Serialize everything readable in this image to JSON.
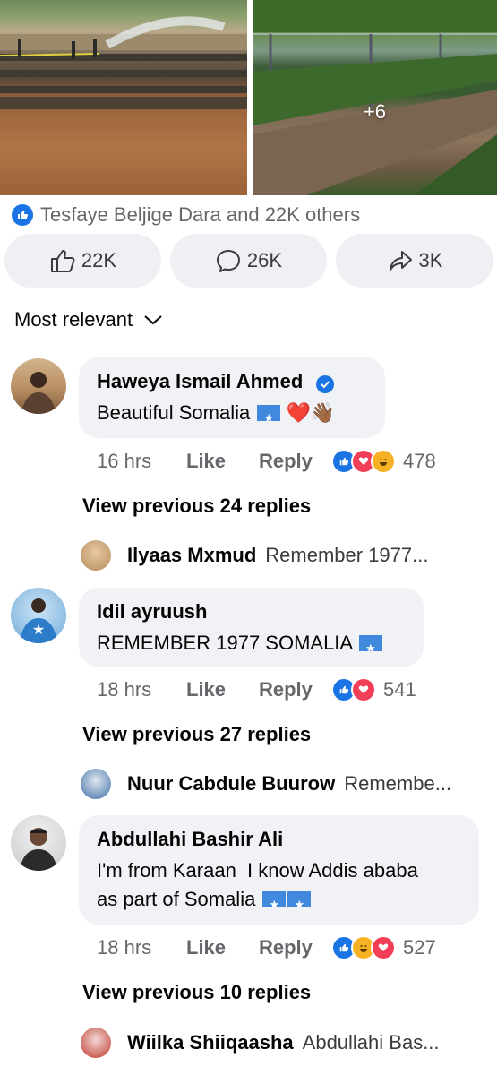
{
  "post": {
    "more_photos": "+6",
    "reactions_summary": "Tesfaye Beljige Dara and 22K others",
    "actions": {
      "like_count": "22K",
      "comment_count": "26K",
      "share_count": "3K"
    }
  },
  "sort": {
    "label": "Most relevant"
  },
  "comments": [
    {
      "name": "Haweya Ismail Ahmed",
      "verified": true,
      "text": "Beautiful Somalia",
      "emoji": "❤️👋🏾",
      "time": "16 hrs",
      "like": "Like",
      "reply": "Reply",
      "reactions": [
        "like",
        "love",
        "haha"
      ],
      "reaction_count": "478",
      "view_previous": "View previous 24 replies",
      "latest_reply": {
        "name": "Ilyaas Mxmud",
        "text": "Remember 1977..."
      }
    },
    {
      "name": "Idil ayruush",
      "verified": false,
      "text": "REMEMBER 1977 SOMALIA",
      "time": "18 hrs",
      "like": "Like",
      "reply": "Reply",
      "reactions": [
        "like",
        "love"
      ],
      "reaction_count": "541",
      "view_previous": "View previous 27 replies",
      "latest_reply": {
        "name": "Nuur Cabdule Buurow",
        "text": "Remembe..."
      }
    },
    {
      "name": "Abdullahi Bashir Ali",
      "verified": false,
      "text_line1": "I'm from Karaan  I know Addis ababa",
      "text_line2": "as part of Somalia",
      "time": "18 hrs",
      "like": "Like",
      "reply": "Reply",
      "reactions": [
        "like",
        "haha",
        "love"
      ],
      "reaction_count": "527",
      "view_previous": "View previous 10 replies",
      "latest_reply": {
        "name": "Wiilka Shiiqaasha",
        "text": "Abdullahi Bas..."
      }
    }
  ],
  "colors": {
    "accent": "#1b74e4",
    "love": "#f33e58",
    "haha": "#f7b125",
    "bubble": "#f0f2f5",
    "secondary_text": "#65676b"
  }
}
